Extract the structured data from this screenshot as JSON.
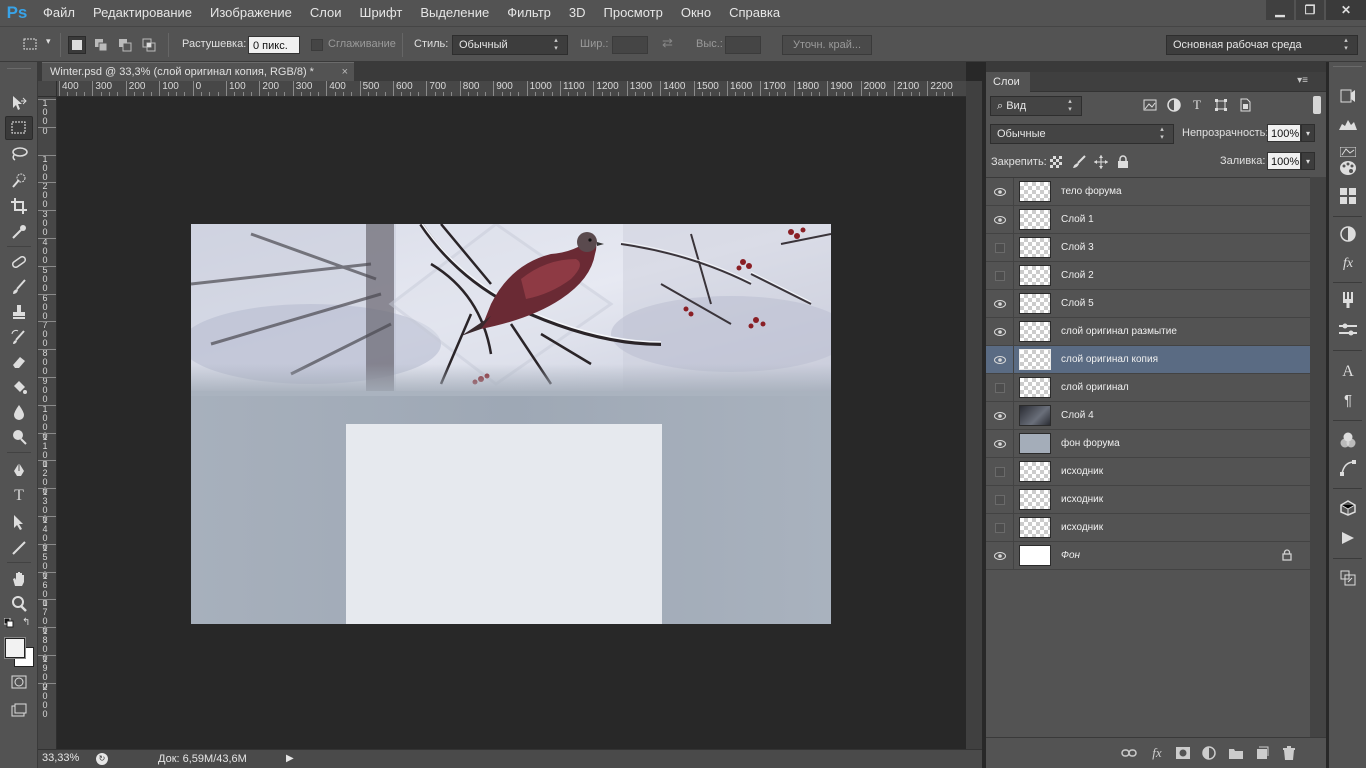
{
  "app": {
    "logo": "Ps",
    "menu": [
      "Файл",
      "Редактирование",
      "Изображение",
      "Слои",
      "Шрифт",
      "Выделение",
      "Фильтр",
      "3D",
      "Просмотр",
      "Окно",
      "Справка"
    ],
    "window_buttons": {
      "minimize": "▁",
      "restore": "❐",
      "close": "✕"
    }
  },
  "options_bar": {
    "feather_label": "Растушевка:",
    "feather_value": "0 пикс.",
    "antialias_label": "Сглаживание",
    "style_label": "Стиль:",
    "style_value": "Обычный",
    "width_label": "Шир.:",
    "height_label": "Выс.:",
    "refine_edge": "Уточн. край...",
    "workspace": "Основная рабочая среда"
  },
  "document": {
    "tab_title": "Winter.psd @ 33,3% (слой оригинал копия, RGB/8) *",
    "tab_close": "×",
    "ruler_top_labels": [
      "400",
      "300",
      "200",
      "100",
      "0",
      "100",
      "200",
      "300",
      "400",
      "500",
      "600",
      "700",
      "800",
      "900",
      "1000",
      "1100",
      "1200",
      "1300",
      "1400",
      "1500",
      "1600",
      "1700",
      "1800",
      "1900",
      "2000",
      "2100",
      "2200"
    ],
    "ruler_left_labels": [
      "1\n0\n0",
      "0",
      "1\n0\n0",
      "2\n0\n0",
      "3\n0\n0",
      "4\n0\n0",
      "5\n0\n0",
      "6\n0\n0",
      "7\n0\n0",
      "8\n0\n0",
      "9\n0\n0",
      "1\n0\n0\n0",
      "1\n1\n0\n0",
      "1\n2\n0\n0",
      "1\n3\n0\n0",
      "1\n4\n0\n0",
      "1\n5\n0\n0",
      "1\n6\n0\n0",
      "1\n7\n0\n0",
      "1\n8\n0\n0",
      "1\n9\n0\n0",
      "2\n0\n0\n0"
    ],
    "canvas_colors": {
      "header_sky": "#d7dae6",
      "body": "#a4adb9",
      "content_box": "#e6e9ee"
    }
  },
  "status": {
    "zoom": "33,33%",
    "doc_info": "Док: 6,59M/43,6M",
    "arrow": "▶"
  },
  "layers_panel": {
    "tab_label": "Слои",
    "menu_icon": "▾≡",
    "filter_kind": "Вид",
    "blend_mode": "Обычные",
    "opacity_label": "Непрозрачность:",
    "opacity_value": "100%",
    "lock_label": "Закрепить:",
    "fill_label": "Заливка:",
    "fill_value": "100%",
    "layers": [
      {
        "name": "тело форума",
        "visible": true,
        "thumb": "transparent",
        "selected": false,
        "locked": false,
        "italic": false
      },
      {
        "name": "Слой 1",
        "visible": true,
        "thumb": "transparent",
        "selected": false,
        "locked": false,
        "italic": false
      },
      {
        "name": "Слой 3",
        "visible": false,
        "thumb": "transparent",
        "selected": false,
        "locked": false,
        "italic": false
      },
      {
        "name": "Слой 2",
        "visible": false,
        "thumb": "transparent",
        "selected": false,
        "locked": false,
        "italic": false
      },
      {
        "name": "Слой 5",
        "visible": true,
        "thumb": "transparent",
        "selected": false,
        "locked": false,
        "italic": false
      },
      {
        "name": "слой оригинал размытие",
        "visible": true,
        "thumb": "transparent",
        "selected": false,
        "locked": false,
        "italic": false
      },
      {
        "name": "слой оригинал копия",
        "visible": true,
        "thumb": "transparent",
        "selected": true,
        "locked": false,
        "italic": false
      },
      {
        "name": "слой оригинал",
        "visible": false,
        "thumb": "transparent",
        "selected": false,
        "locked": false,
        "italic": false
      },
      {
        "name": "Слой 4",
        "visible": true,
        "thumb": "dark",
        "selected": false,
        "locked": false,
        "italic": false
      },
      {
        "name": "фон форума",
        "visible": true,
        "thumb": "gray",
        "selected": false,
        "locked": false,
        "italic": false
      },
      {
        "name": "исходник",
        "visible": false,
        "thumb": "transparent",
        "selected": false,
        "locked": false,
        "italic": false
      },
      {
        "name": "исходник",
        "visible": false,
        "thumb": "transparent",
        "selected": false,
        "locked": false,
        "italic": false
      },
      {
        "name": "исходник",
        "visible": false,
        "thumb": "transparent",
        "selected": false,
        "locked": false,
        "italic": false
      },
      {
        "name": "Фон",
        "visible": true,
        "thumb": "white",
        "selected": false,
        "locked": true,
        "italic": true
      }
    ]
  }
}
